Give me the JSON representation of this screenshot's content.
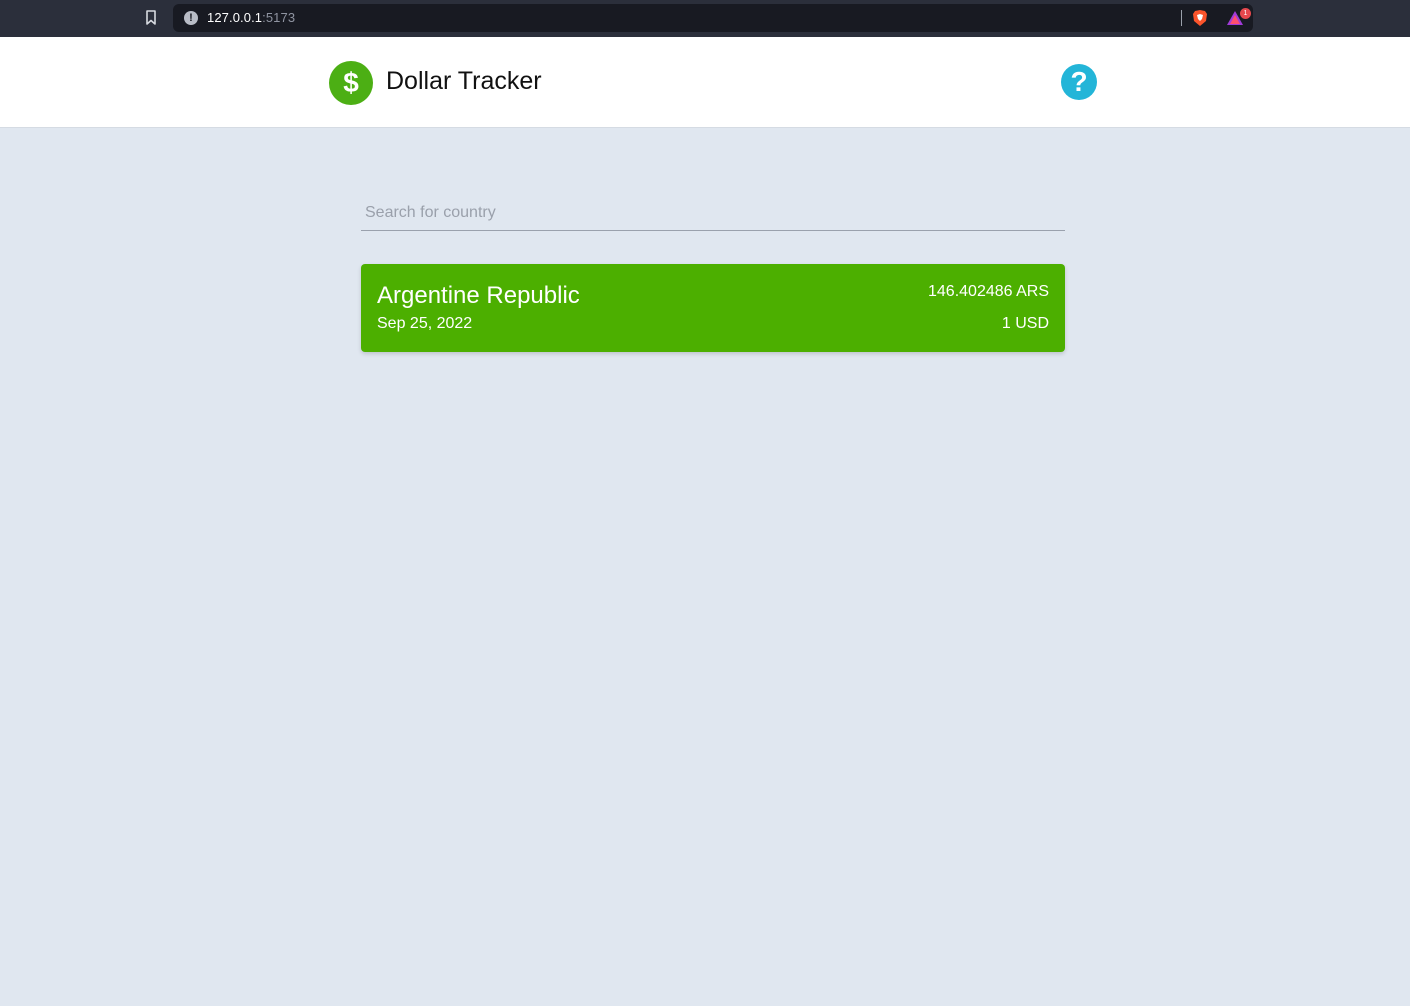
{
  "browser": {
    "url_host": "127.0.0.1",
    "url_port": ":5173",
    "rewards_badge": "1",
    "icons": [
      "bookmark-icon",
      "info-icon",
      "brave-shield-icon",
      "brave-rewards-icon"
    ]
  },
  "header": {
    "logo_symbol": "$",
    "title": "Dollar Tracker",
    "help_symbol": "?"
  },
  "search": {
    "placeholder": "Search for country",
    "value": ""
  },
  "results": [
    {
      "country": "Argentine Republic",
      "date": "Sep 25, 2022",
      "rate": "146.402486 ARS",
      "base": "1 USD"
    }
  ],
  "colors": {
    "brand_green": "#4caf00",
    "help_blue": "#23b5d8",
    "page_bg": "#e0e7f0",
    "browser_bar": "#2b2f3b"
  }
}
